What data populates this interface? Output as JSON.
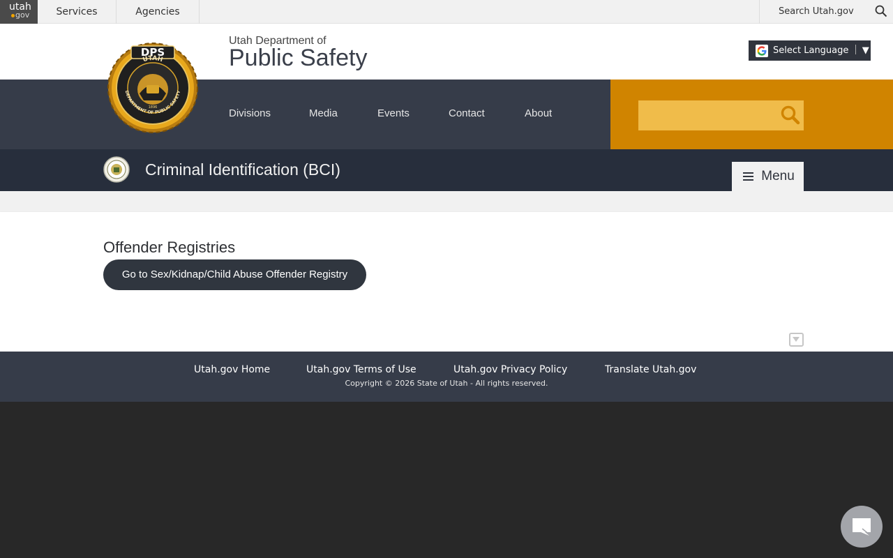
{
  "utah_bar": {
    "logo_top": "utah",
    "logo_bottom": "gov",
    "tabs": [
      "Services",
      "Agencies"
    ],
    "search_label": "Search Utah.gov"
  },
  "agency": {
    "pre_title": "Utah Department of",
    "title": "Public Safety",
    "language_label": "Select Language",
    "language_caret": "▼"
  },
  "seal": {
    "top_text": "DPS",
    "arc_text": "UTAH",
    "ring_text": "DEPARTMENT OF PUBLIC SAFETY"
  },
  "nav": {
    "items": [
      "Divisions",
      "Media",
      "Events",
      "Contact",
      "About"
    ],
    "search_value": ""
  },
  "bci": {
    "title": "Criminal Identification (BCI)",
    "menu_label": "Menu"
  },
  "content": {
    "heading": "Offender Registries",
    "button_label": "Go to Sex/Kidnap/Child Abuse Offender Registry"
  },
  "footer": {
    "links": [
      "Utah.gov Home",
      "Utah.gov Terms of Use",
      "Utah.gov Privacy Policy",
      "Translate Utah.gov"
    ],
    "copyright": "Copyright © 2026 State of Utah - All rights reserved."
  },
  "colors": {
    "nav_bg": "#363c49",
    "bci_bg": "#272e3c",
    "accent_orange": "#d08400",
    "search_field": "#f0bc4a",
    "footer_bg": "#363c49",
    "page_bg": "#282828"
  },
  "icons": [
    "search-icon",
    "google-icon",
    "menu-bars-icon",
    "collapse-toggle-icon",
    "chat-icon"
  ]
}
